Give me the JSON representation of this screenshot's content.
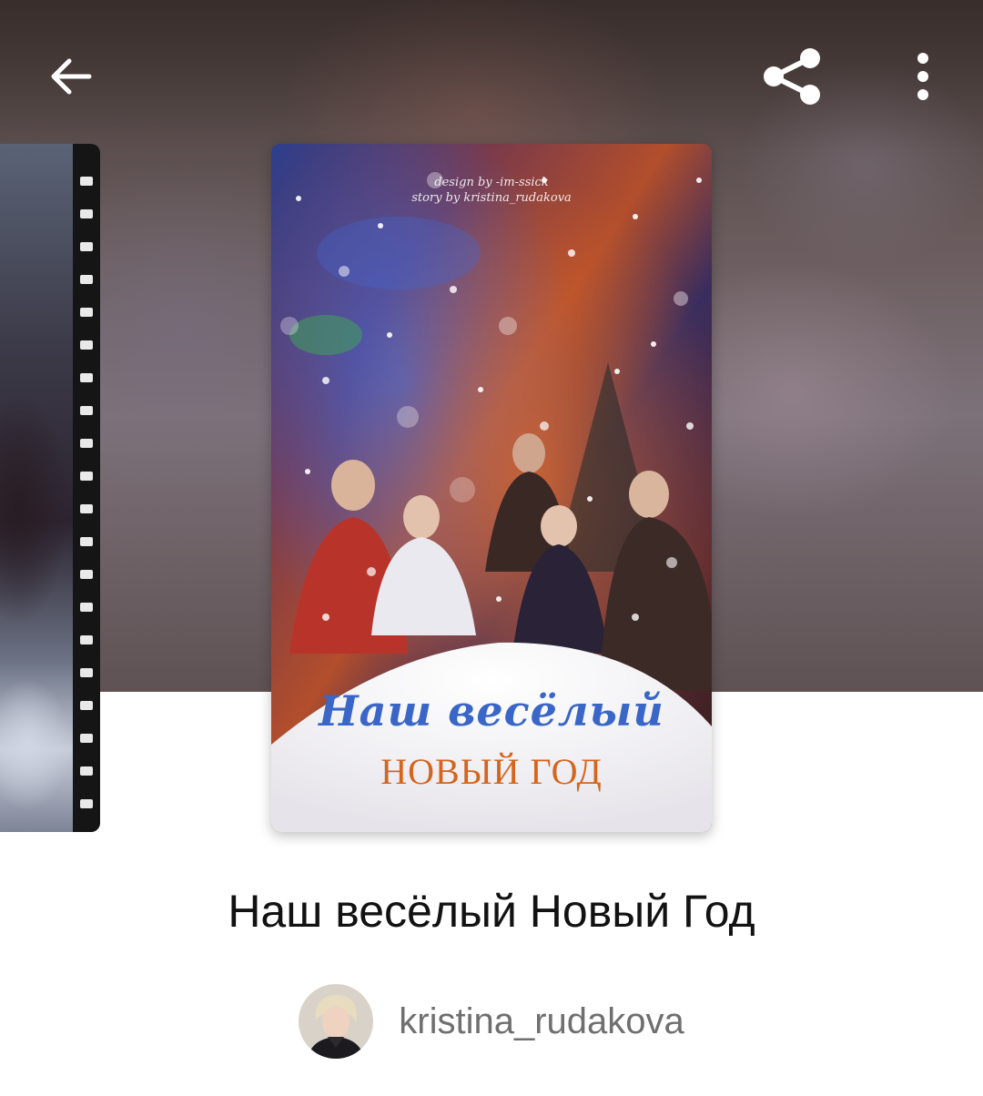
{
  "topbar": {
    "back_icon": "arrow-left-icon",
    "share_icon": "share-icon",
    "more_icon": "more-vertical-icon",
    "icon_color": "#ffffff"
  },
  "cover": {
    "credit_design": "design by -im-ssick",
    "credit_story": "story by kristina_rudakova",
    "title_script": "Наш весёлый",
    "title_caps": "НОВЫЙ ГОД"
  },
  "story": {
    "title": "Наш весёлый Новый Год"
  },
  "author": {
    "username": "kristina_rudakova"
  }
}
